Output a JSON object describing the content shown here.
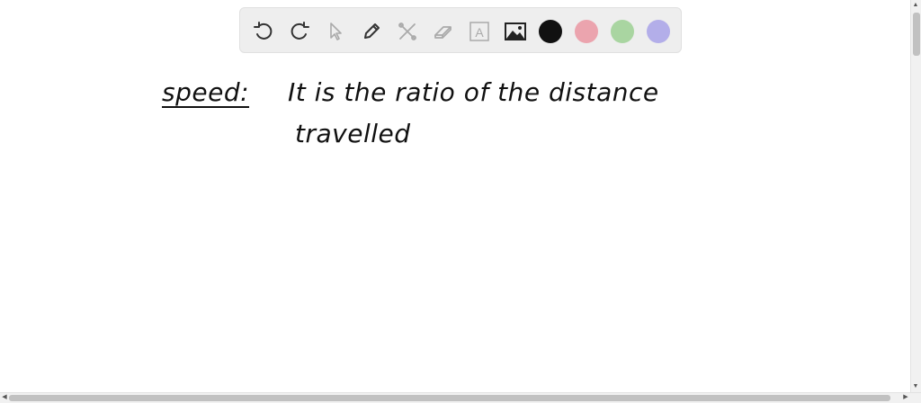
{
  "toolbar": {
    "tools": [
      {
        "icon": "undo-icon"
      },
      {
        "icon": "redo-icon"
      },
      {
        "icon": "pointer-icon"
      },
      {
        "icon": "pen-icon"
      },
      {
        "icon": "tools-icon"
      },
      {
        "icon": "eraser-icon"
      },
      {
        "icon": "text-icon",
        "glyph": "A"
      },
      {
        "icon": "image-icon"
      }
    ],
    "colors": [
      "#111111",
      "#eba4ae",
      "#a9d5a1",
      "#b3aee9"
    ],
    "selected_color": "#111111"
  },
  "canvas": {
    "heading": "speed:",
    "line1": "It  is the ratio of the distance",
    "line2": "travelled"
  },
  "scrollbars": {
    "arrow_up": "▲",
    "arrow_down": "▼",
    "arrow_left": "◀",
    "arrow_right": "▶"
  }
}
